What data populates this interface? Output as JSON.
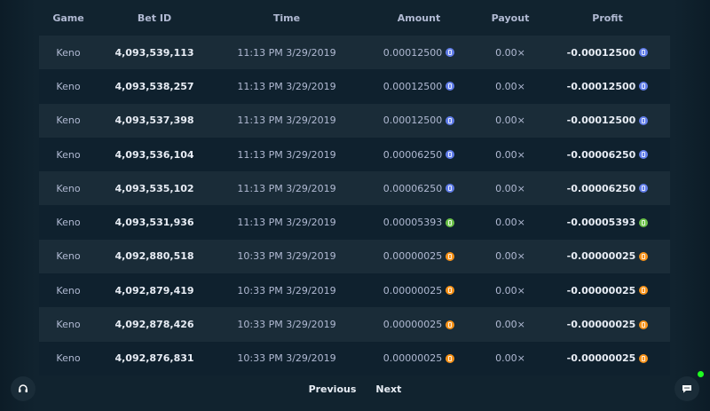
{
  "table": {
    "headers": {
      "game": "Game",
      "bet_id": "Bet ID",
      "time": "Time",
      "amount": "Amount",
      "payout": "Payout",
      "profit": "Profit"
    },
    "rows": [
      {
        "game": "Keno",
        "bet_id": "4,093,539,113",
        "time": "11:13 PM 3/29/2019",
        "amount": "0.00012500",
        "payout": "0.00×",
        "profit": "-0.00012500",
        "currency": "eth"
      },
      {
        "game": "Keno",
        "bet_id": "4,093,538,257",
        "time": "11:13 PM 3/29/2019",
        "amount": "0.00012500",
        "payout": "0.00×",
        "profit": "-0.00012500",
        "currency": "eth"
      },
      {
        "game": "Keno",
        "bet_id": "4,093,537,398",
        "time": "11:13 PM 3/29/2019",
        "amount": "0.00012500",
        "payout": "0.00×",
        "profit": "-0.00012500",
        "currency": "eth"
      },
      {
        "game": "Keno",
        "bet_id": "4,093,536,104",
        "time": "11:13 PM 3/29/2019",
        "amount": "0.00006250",
        "payout": "0.00×",
        "profit": "-0.00006250",
        "currency": "eth"
      },
      {
        "game": "Keno",
        "bet_id": "4,093,535,102",
        "time": "11:13 PM 3/29/2019",
        "amount": "0.00006250",
        "payout": "0.00×",
        "profit": "-0.00006250",
        "currency": "eth"
      },
      {
        "game": "Keno",
        "bet_id": "4,093,531,936",
        "time": "11:13 PM 3/29/2019",
        "amount": "0.00005393",
        "payout": "0.00×",
        "profit": "-0.00005393",
        "currency": "bch"
      },
      {
        "game": "Keno",
        "bet_id": "4,092,880,518",
        "time": "10:33 PM 3/29/2019",
        "amount": "0.00000025",
        "payout": "0.00×",
        "profit": "-0.00000025",
        "currency": "btc"
      },
      {
        "game": "Keno",
        "bet_id": "4,092,879,419",
        "time": "10:33 PM 3/29/2019",
        "amount": "0.00000025",
        "payout": "0.00×",
        "profit": "-0.00000025",
        "currency": "btc"
      },
      {
        "game": "Keno",
        "bet_id": "4,092,878,426",
        "time": "10:33 PM 3/29/2019",
        "amount": "0.00000025",
        "payout": "0.00×",
        "profit": "-0.00000025",
        "currency": "btc"
      },
      {
        "game": "Keno",
        "bet_id": "4,092,876,831",
        "time": "10:33 PM 3/29/2019",
        "amount": "0.00000025",
        "payout": "0.00×",
        "profit": "-0.00000025",
        "currency": "btc"
      }
    ]
  },
  "pagination": {
    "previous": "Previous",
    "next": "Next"
  },
  "icons": {
    "support": "headset-icon",
    "chat": "chat-icon"
  },
  "colors": {
    "eth": "#627eea",
    "bch": "#6cc24a",
    "btc": "#f7931a",
    "online": "#1fff20"
  }
}
